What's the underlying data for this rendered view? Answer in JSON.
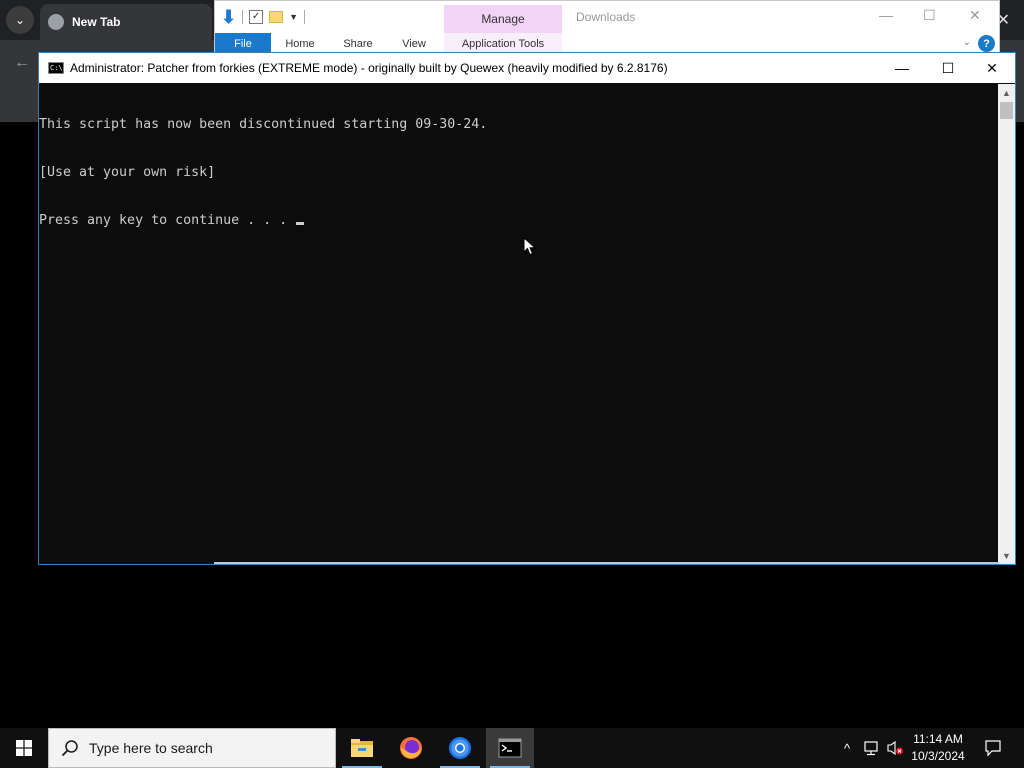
{
  "browser": {
    "tab_title": "New Tab",
    "close_glyph": "✕",
    "back_glyph": "←",
    "menu_glyph": "⌄"
  },
  "explorer": {
    "manage_label": "Manage",
    "app_tools_label": "Application Tools",
    "window_title": "Downloads",
    "ribbon_tabs": [
      "File",
      "Home",
      "Share",
      "View"
    ],
    "help_glyph": "?",
    "minimize_glyph": "—",
    "maximize_glyph": "☐",
    "close_glyph": "✕"
  },
  "console": {
    "icon_text": "C:\\",
    "title": "Administrator:  Patcher from forkies (EXTREME mode) - originally built by Quewex (heavily modified by 6.2.8176)",
    "minimize_glyph": "—",
    "maximize_glyph": "☐",
    "close_glyph": "✕",
    "lines": [
      "This script has now been discontinued starting 09-30-24.",
      "[Use at your own risk]",
      "Press any key to continue . . ."
    ],
    "scroll_up_glyph": "▲",
    "scroll_down_glyph": "▼"
  },
  "taskbar": {
    "search_placeholder": "Type here to search",
    "apps": [
      "file-explorer",
      "firefox",
      "chrome",
      "command-prompt"
    ],
    "active_app": "command-prompt",
    "clock_time": "11:14 AM",
    "clock_date": "10/3/2024",
    "tray_chevron": "^"
  },
  "colors": {
    "console_bg": "#0c0c0c",
    "console_text": "#cccccc",
    "taskbar_bg": "#101010",
    "accent": "#1979ca",
    "manage_tab": "#f3d4f8"
  }
}
